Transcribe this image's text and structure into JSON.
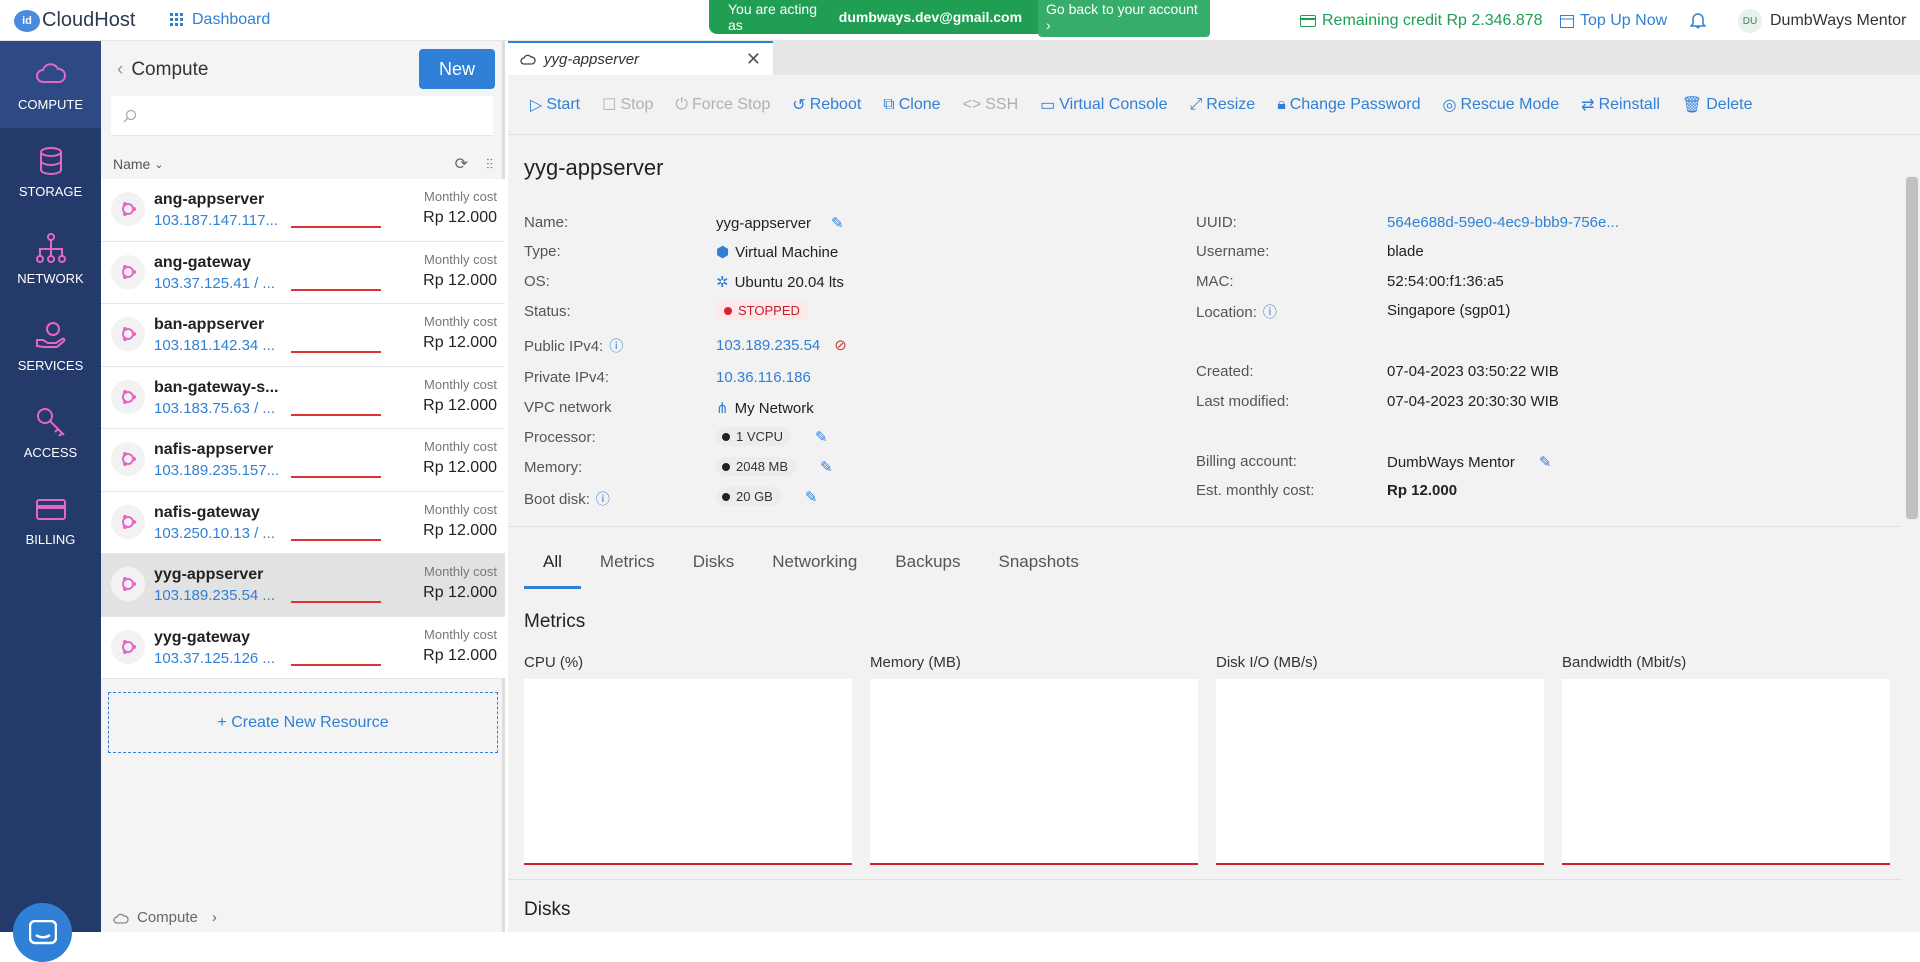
{
  "topbar": {
    "brand": "CloudHost",
    "brand_badge": "id",
    "dashboard": "Dashboard",
    "acting_prefix": "You are acting as",
    "acting_email": "dumbways.dev@gmail.com",
    "go_back": "Go back to your account ›",
    "credit": "Remaining credit Rp 2.346.878",
    "topup": "Top Up Now",
    "user_initials": "DU",
    "user_name": "DumbWays Mentor"
  },
  "nav": [
    {
      "label": "COMPUTE",
      "icon": "cloud-icon"
    },
    {
      "label": "STORAGE",
      "icon": "database-icon"
    },
    {
      "label": "NETWORK",
      "icon": "network-icon"
    },
    {
      "label": "SERVICES",
      "icon": "services-icon"
    },
    {
      "label": "ACCESS",
      "icon": "key-icon"
    },
    {
      "label": "BILLING",
      "icon": "card-icon"
    }
  ],
  "list": {
    "heading": "Compute",
    "new_label": "New",
    "search_placeholder": "",
    "sort_label": "Name",
    "cost_label": "Monthly cost",
    "items": [
      {
        "name": "ang-appserver",
        "ip": "103.187.147.117...",
        "price": "Rp 12.000"
      },
      {
        "name": "ang-gateway",
        "ip": "103.37.125.41 / ...",
        "price": "Rp 12.000"
      },
      {
        "name": "ban-appserver",
        "ip": "103.181.142.34 ...",
        "price": "Rp 12.000"
      },
      {
        "name": "ban-gateway-s...",
        "ip": "103.183.75.63 / ...",
        "price": "Rp 12.000"
      },
      {
        "name": "nafis-appserver",
        "ip": "103.189.235.157...",
        "price": "Rp 12.000"
      },
      {
        "name": "nafis-gateway",
        "ip": "103.250.10.13 / ...",
        "price": "Rp 12.000"
      },
      {
        "name": "yyg-appserver",
        "ip": "103.189.235.54 ...",
        "price": "Rp 12.000"
      },
      {
        "name": "yyg-gateway",
        "ip": "103.37.125.126 ...",
        "price": "Rp 12.000"
      }
    ],
    "create_label": "+ Create New Resource",
    "footer": "Compute"
  },
  "main": {
    "tab_title": "yyg-appserver",
    "toolbar": [
      "Start",
      "Stop",
      "Force Stop",
      "Reboot",
      "Clone",
      "SSH",
      "Virtual Console",
      "Resize",
      "Change Password",
      "Rescue Mode",
      "Reinstall",
      "Delete"
    ],
    "title": "yyg-appserver",
    "left": {
      "name_k": "Name:",
      "name_v": "yyg-appserver",
      "type_k": "Type:",
      "type_v": "Virtual Machine",
      "os_k": "OS:",
      "os_v": "Ubuntu 20.04 lts",
      "status_k": "Status:",
      "status_v": "STOPPED",
      "pub_k": "Public IPv4:",
      "pub_v": "103.189.235.54",
      "priv_k": "Private IPv4:",
      "priv_v": "10.36.116.186",
      "vpc_k": "VPC network",
      "vpc_v": "My Network",
      "cpu_k": "Processor:",
      "cpu_v": "1 VCPU",
      "mem_k": "Memory:",
      "mem_v": "2048 MB",
      "disk_k": "Boot disk:",
      "disk_v": "20 GB"
    },
    "right": {
      "uuid_k": "UUID:",
      "uuid_v": "564e688d-59e0-4ec9-bbb9-756e...",
      "user_k": "Username:",
      "user_v": "blade",
      "mac_k": "MAC:",
      "mac_v": "52:54:00:f1:36:a5",
      "loc_k": "Location:",
      "loc_v": "Singapore (sgp01)",
      "created_k": "Created:",
      "created_v": "07-04-2023 03:50:22 WIB",
      "mod_k": "Last modified:",
      "mod_v": "07-04-2023 20:30:30 WIB",
      "bill_k": "Billing account:",
      "bill_v": "DumbWays Mentor",
      "cost_k": "Est. monthly cost:",
      "cost_v": "Rp 12.000"
    },
    "tabs": [
      "All",
      "Metrics",
      "Disks",
      "Networking",
      "Backups",
      "Snapshots"
    ],
    "metrics_heading": "Metrics",
    "metrics": [
      "CPU (%)",
      "Memory (MB)",
      "Disk I/O (MB/s)",
      "Bandwidth (Mbit/s)"
    ],
    "disks_heading": "Disks"
  }
}
